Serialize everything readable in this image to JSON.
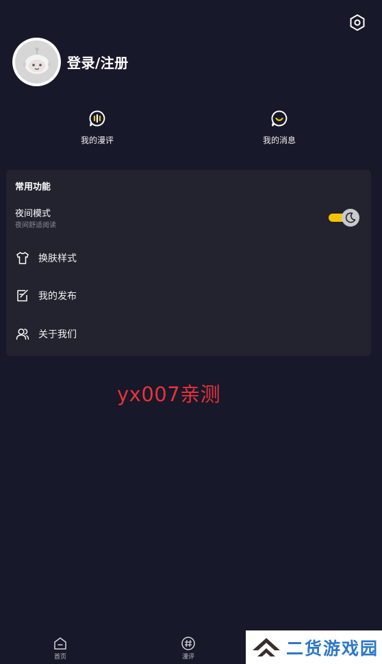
{
  "header": {
    "settings_icon": "gear-hexagon-icon",
    "login_label": "登录/注册",
    "avatar_icon": "robot-avatar-icon"
  },
  "quick_links": [
    {
      "label": "我的漫评",
      "icon": "review-bubble-icon"
    },
    {
      "label": "我的消息",
      "icon": "message-smile-icon"
    }
  ],
  "features": {
    "title": "常用功能",
    "night_mode": {
      "title": "夜间模式",
      "subtitle": "夜间舒适阅读",
      "enabled": true
    },
    "items": [
      {
        "label": "换肤样式",
        "icon": "shirt-icon"
      },
      {
        "label": "我的发布",
        "icon": "edit-icon"
      },
      {
        "label": "关于我们",
        "icon": "users-icon"
      }
    ]
  },
  "watermark": "yx007亲测",
  "tabbar": [
    {
      "label": "首页",
      "icon": "home-icon"
    },
    {
      "label": "漫评",
      "icon": "hashtag-icon"
    }
  ],
  "brand": {
    "text": "二货游戏园"
  },
  "colors": {
    "background": "#171829",
    "card": "#22232f",
    "accent": "#f5c400",
    "watermark": "#e8333a",
    "brand": "#2c78c9"
  }
}
